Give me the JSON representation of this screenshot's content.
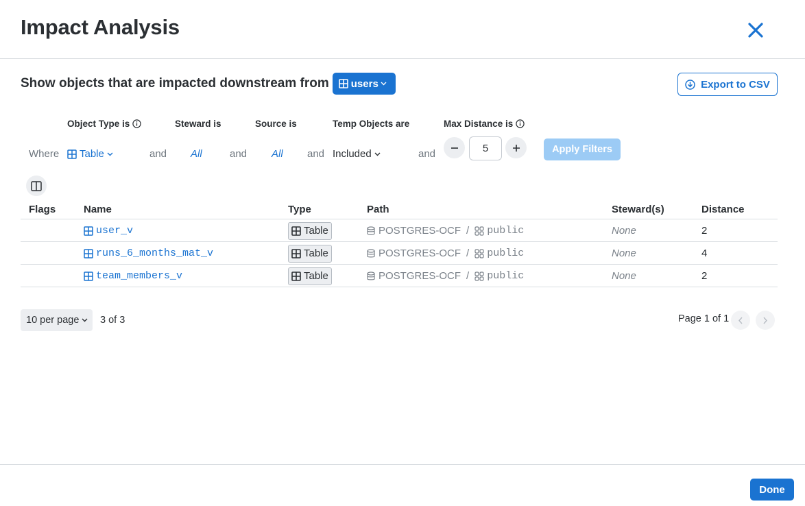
{
  "dialog": {
    "title": "Impact Analysis"
  },
  "source": {
    "prompt": "Show objects that are impacted downstream from",
    "name": "users"
  },
  "export_label": "Export to CSV",
  "filters": {
    "where_label": "Where",
    "and_label": "and",
    "object_type": {
      "label": "Object Type is",
      "value": "Table"
    },
    "steward": {
      "label": "Steward is",
      "value": "All"
    },
    "source": {
      "label": "Source is",
      "value": "All"
    },
    "temp_objects": {
      "label": "Temp Objects are",
      "value": "Included"
    },
    "max_distance": {
      "label": "Max Distance is",
      "value": "5"
    },
    "apply_label": "Apply Filters"
  },
  "table": {
    "headers": {
      "flags": "Flags",
      "name": "Name",
      "type": "Type",
      "path": "Path",
      "stewards": "Steward(s)",
      "distance": "Distance"
    },
    "rows": [
      {
        "name": "user_v",
        "type": "Table",
        "database": "POSTGRES-OCF",
        "schema": "public",
        "steward": "None",
        "distance": "2"
      },
      {
        "name": "runs_6_months_mat_v",
        "type": "Table",
        "database": "POSTGRES-OCF",
        "schema": "public",
        "steward": "None",
        "distance": "4"
      },
      {
        "name": "team_members_v",
        "type": "Table",
        "database": "POSTGRES-OCF",
        "schema": "public",
        "steward": "None",
        "distance": "2"
      }
    ]
  },
  "pagination": {
    "per_page": "10 per page",
    "count": "3 of 3",
    "page": "Page 1 of 1"
  },
  "done_label": "Done",
  "colors": {
    "accent": "#1a73d1",
    "apply_disabled": "#9ccbf5",
    "muted": "#7a8189"
  }
}
